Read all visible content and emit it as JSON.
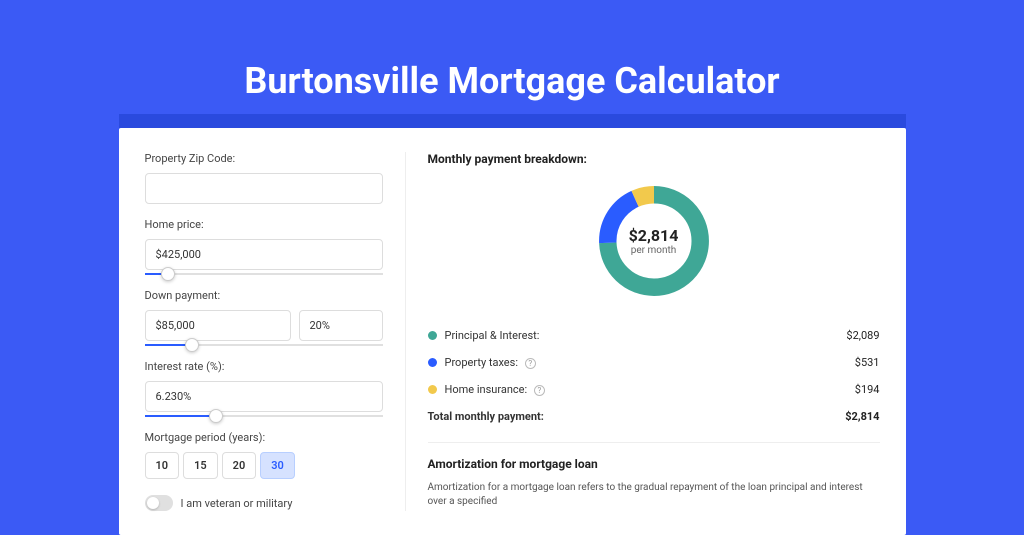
{
  "header": {
    "title": "Burtonsville Mortgage Calculator"
  },
  "form": {
    "zip": {
      "label": "Property Zip Code:",
      "value": ""
    },
    "price": {
      "label": "Home price:",
      "value": "$425,000",
      "slider_pct": 10
    },
    "down": {
      "label": "Down payment:",
      "value": "$85,000",
      "pct": "20%",
      "slider_pct": 20
    },
    "rate": {
      "label": "Interest rate (%):",
      "value": "6.230%",
      "slider_pct": 30
    },
    "period": {
      "label": "Mortgage period (years):",
      "options": [
        "10",
        "15",
        "20",
        "30"
      ],
      "active": "30"
    },
    "veteran": {
      "label": "I am veteran or military"
    }
  },
  "breakdown": {
    "title": "Monthly payment breakdown:",
    "center_value": "$2,814",
    "center_sub": "per month",
    "items": [
      {
        "label": "Principal & Interest:",
        "value": "$2,089",
        "color": "g",
        "info": false
      },
      {
        "label": "Property taxes:",
        "value": "$531",
        "color": "b",
        "info": true
      },
      {
        "label": "Home insurance:",
        "value": "$194",
        "color": "y",
        "info": true
      }
    ],
    "total": {
      "label": "Total monthly payment:",
      "value": "$2,814"
    }
  },
  "amort": {
    "title": "Amortization for mortgage loan",
    "text": "Amortization for a mortgage loan refers to the gradual repayment of the loan principal and interest over a specified"
  },
  "chart_data": {
    "type": "pie",
    "title": "Monthly payment breakdown",
    "series": [
      {
        "name": "Principal & Interest",
        "value": 2089,
        "color": "#3FA796"
      },
      {
        "name": "Property taxes",
        "value": 531,
        "color": "#2A5CFF"
      },
      {
        "name": "Home insurance",
        "value": 194,
        "color": "#F2C94C"
      }
    ],
    "total": 2814,
    "center_label": "$2,814 per month"
  }
}
